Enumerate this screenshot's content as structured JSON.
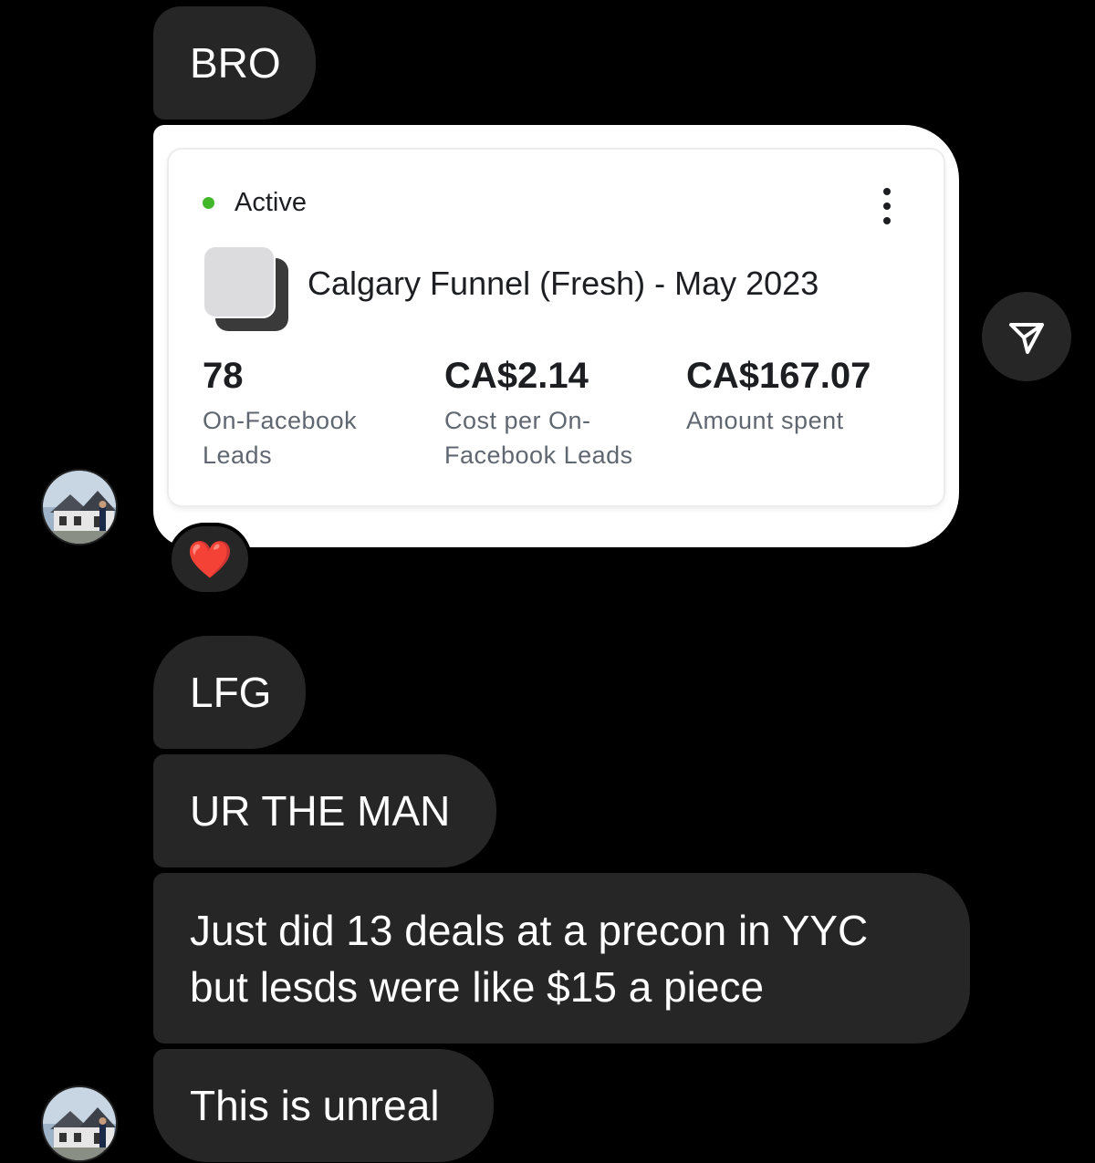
{
  "messages": {
    "bro": "BRO",
    "lfg": "LFG",
    "ur_the_man": "UR THE MAN",
    "deals": "Just did 13 deals at a precon in YYC but lesds were like $15 a piece",
    "unreal": "This is unreal"
  },
  "shared_ad": {
    "status": "Active",
    "status_color": "#42b72a",
    "campaign_name": "Calgary Funnel (Fresh) - May 2023",
    "metrics": [
      {
        "value": "78",
        "label": "On-Facebook Leads"
      },
      {
        "value": "CA$2.14",
        "label": "Cost per On-Facebook Leads"
      },
      {
        "value": "CA$167.07",
        "label": "Amount spent"
      }
    ]
  },
  "reaction": {
    "emoji": "❤️",
    "icon": "heart-icon"
  },
  "icons": {
    "share": "paper-plane-icon",
    "more": "more-vertical-icon"
  },
  "colors": {
    "background": "#000000",
    "bubble": "#262626",
    "card": "#ffffff"
  }
}
